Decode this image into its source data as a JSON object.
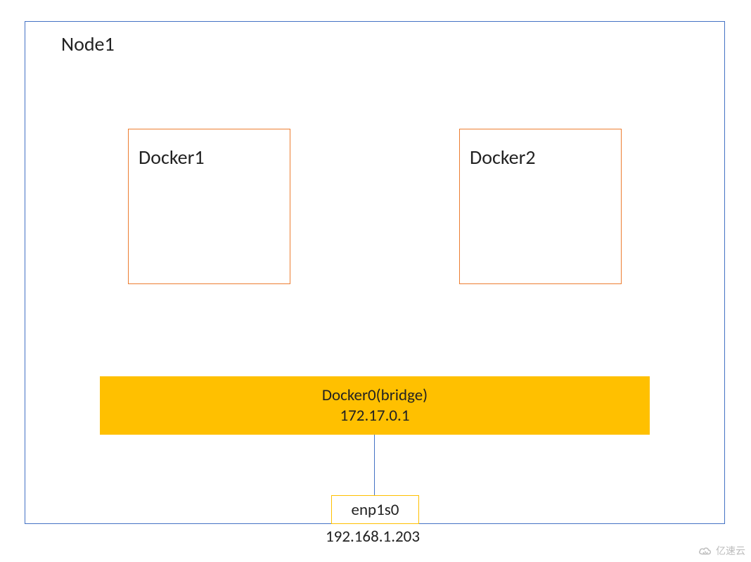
{
  "node": {
    "title": "Node1"
  },
  "containers": {
    "docker1": "Docker1",
    "docker2": "Docker2"
  },
  "bridge": {
    "name": "Docker0(bridge)",
    "ip": "172.17.0.1"
  },
  "nic": {
    "name": "enp1s0",
    "ip": "192.168.1.203"
  },
  "watermark": "亿速云",
  "colors": {
    "node_border": "#4472c4",
    "container_border": "#ed7d31",
    "bridge_fill": "#ffc000"
  }
}
